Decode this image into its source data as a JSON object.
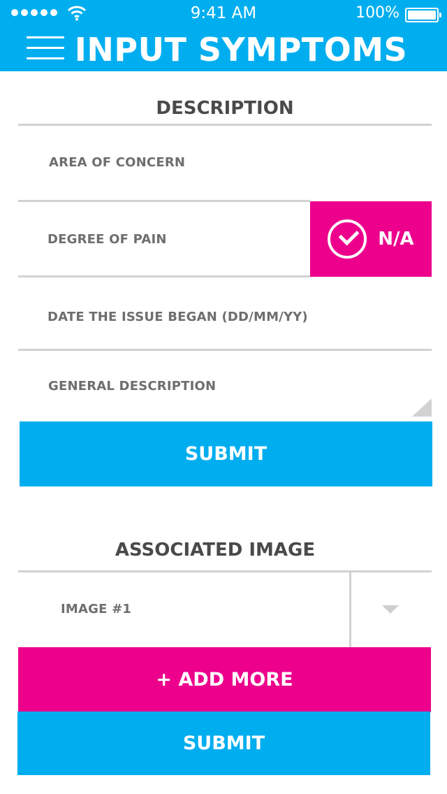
{
  "status_bar": {
    "time": "9:41 AM",
    "battery": "100%"
  },
  "header": {
    "title": "INPUT SYMPTOMS"
  },
  "description": {
    "title": "DESCRIPTION",
    "area_of_concern": "AREA OF CONCERN",
    "degree_of_pain": "DEGREE OF PAIN",
    "na_label": "N/A",
    "date_began": "DATE THE ISSUE BEGAN (DD/MM/YY)",
    "general_description": "GENERAL DESCRIPTION",
    "submit_label": "SUBMIT"
  },
  "associated_image": {
    "title": "ASSOCIATED IMAGE",
    "selected_image": "IMAGE #1",
    "add_more_label": "+ ADD MORE",
    "submit_label": "SUBMIT"
  },
  "colors": {
    "accent_blue": "#00aeef",
    "accent_pink": "#ec008c"
  }
}
